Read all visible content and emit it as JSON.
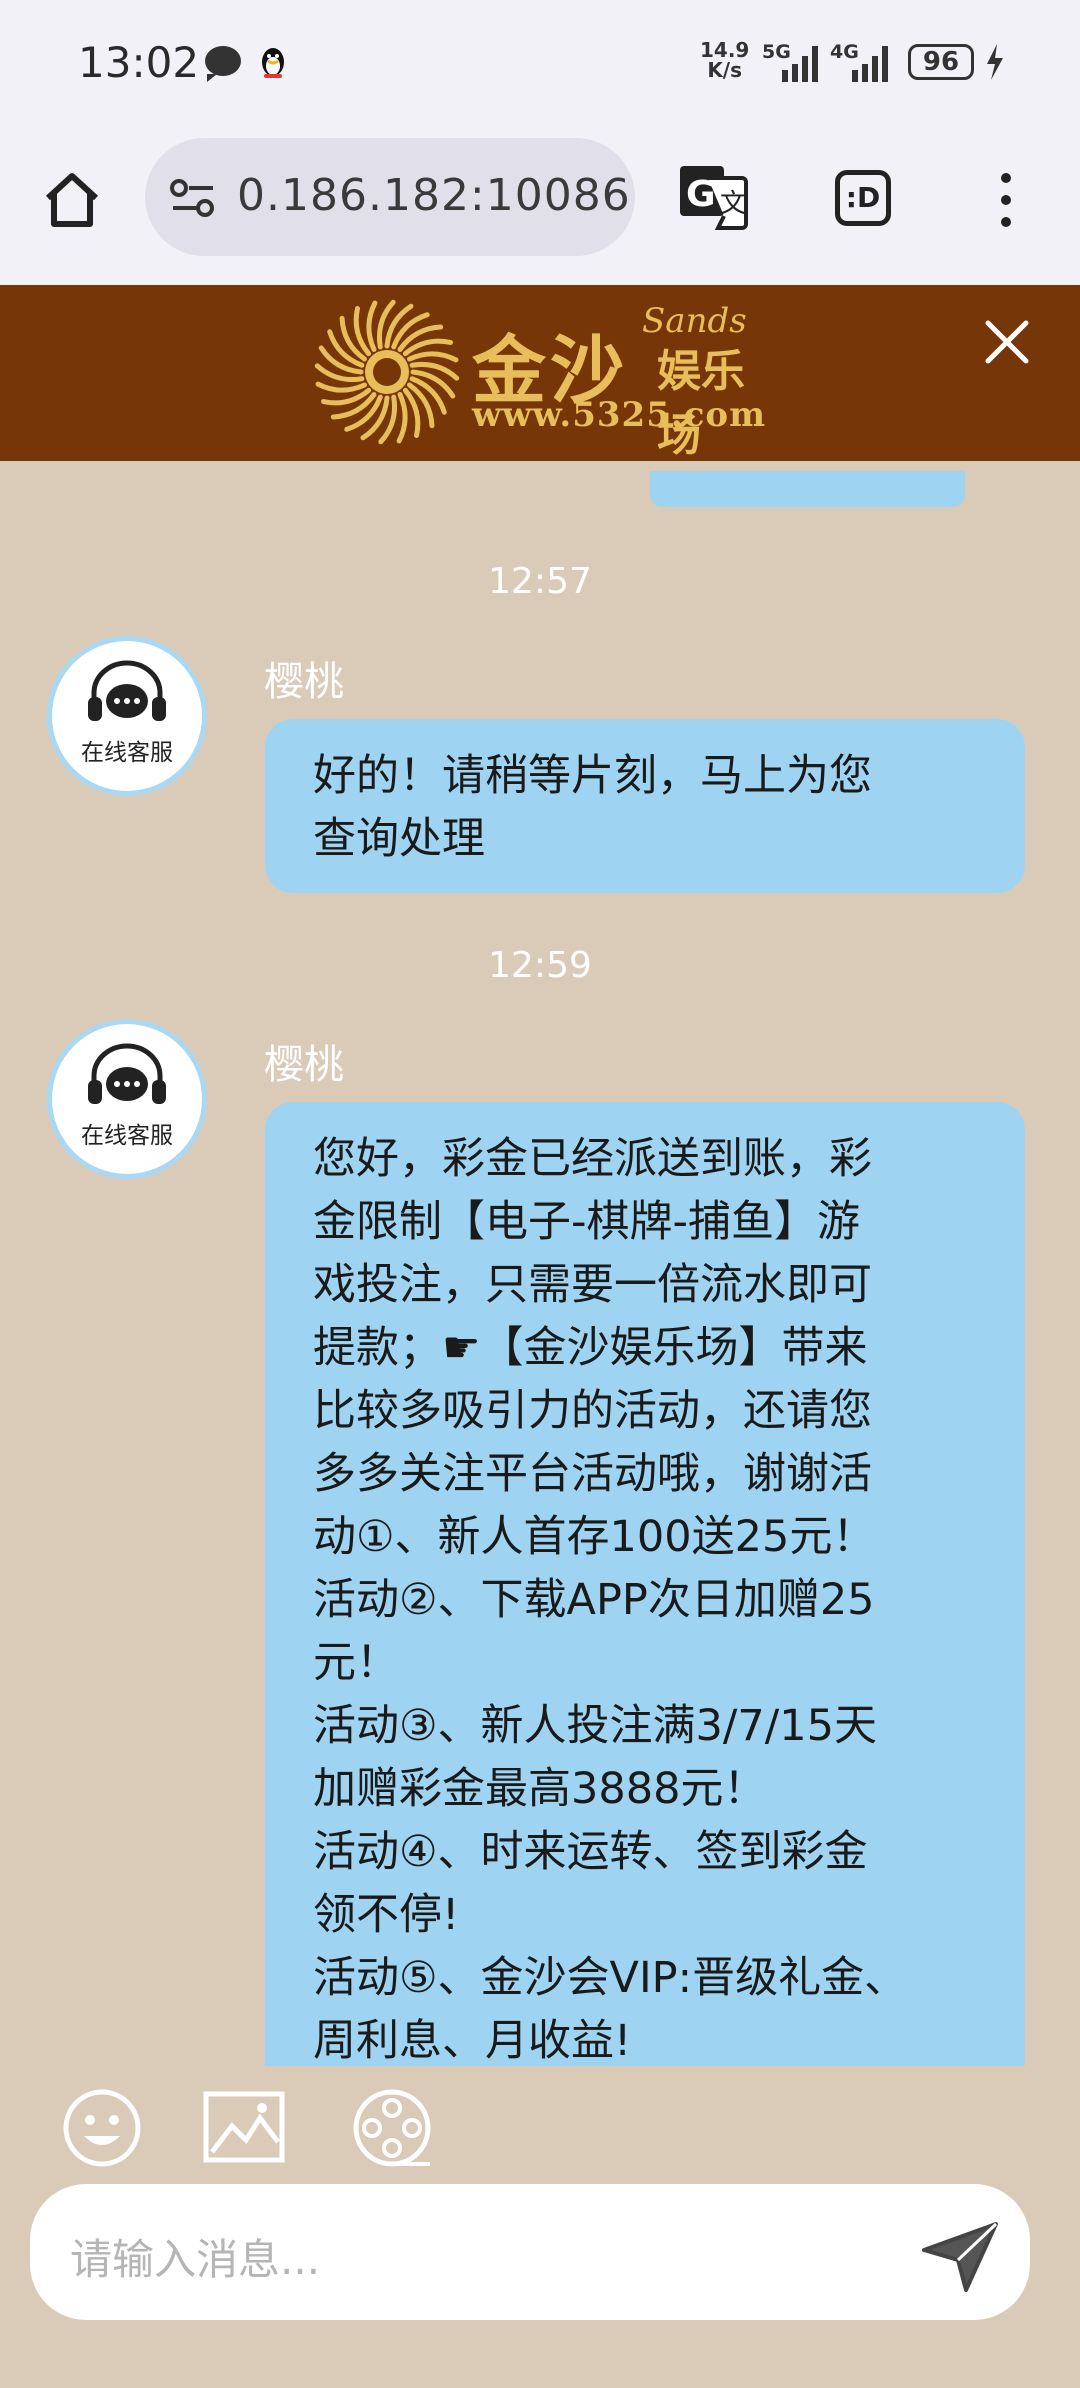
{
  "status_bar": {
    "time": "13:02",
    "net_speed_value": "14.9",
    "net_speed_unit": "K/s",
    "signal_1": "5G",
    "signal_2": "4G",
    "battery": "96"
  },
  "browser": {
    "url": "0.186.182:10086",
    "tab_label": ":D"
  },
  "banner": {
    "logo_cn": "金沙",
    "logo_en": "Sands",
    "logo_sub": "娱乐场",
    "logo_url": "www.5325.com"
  },
  "chat": {
    "messages": [
      {
        "time": "12:57",
        "sender": "樱桃",
        "avatar_label": "在线客服",
        "text": "好的！请稍等片刻，马上为您\n查询处理"
      },
      {
        "time": "12:59",
        "sender": "樱桃",
        "avatar_label": "在线客服",
        "text": "您好，彩金已经派送到账，彩\n金限制【电子-棋牌-捕鱼】游\n戏投注，只需要一倍流水即可\n提款；☛【金沙娱乐场】带来\n比较多吸引力的活动，还请您\n多多关注平台活动哦，谢谢活\n动①、新人首存100送25元！\n活动②、下载APP次日加赠25\n元！\n活动③、新人投注满3/7/15天\n加赠彩金最高3888元！\n活动④、时来运转、签到彩金\n领不停!\n活动⑤、金沙会VIP:晋级礼金、\n周利息、月收益!"
      }
    ]
  },
  "composer": {
    "placeholder": "请输入消息..."
  },
  "colors": {
    "banner_bg": "#773608",
    "chat_bg": "#DACBB9",
    "bubble": "#9ED4F2",
    "logo_gold": "#E8BE5A"
  }
}
